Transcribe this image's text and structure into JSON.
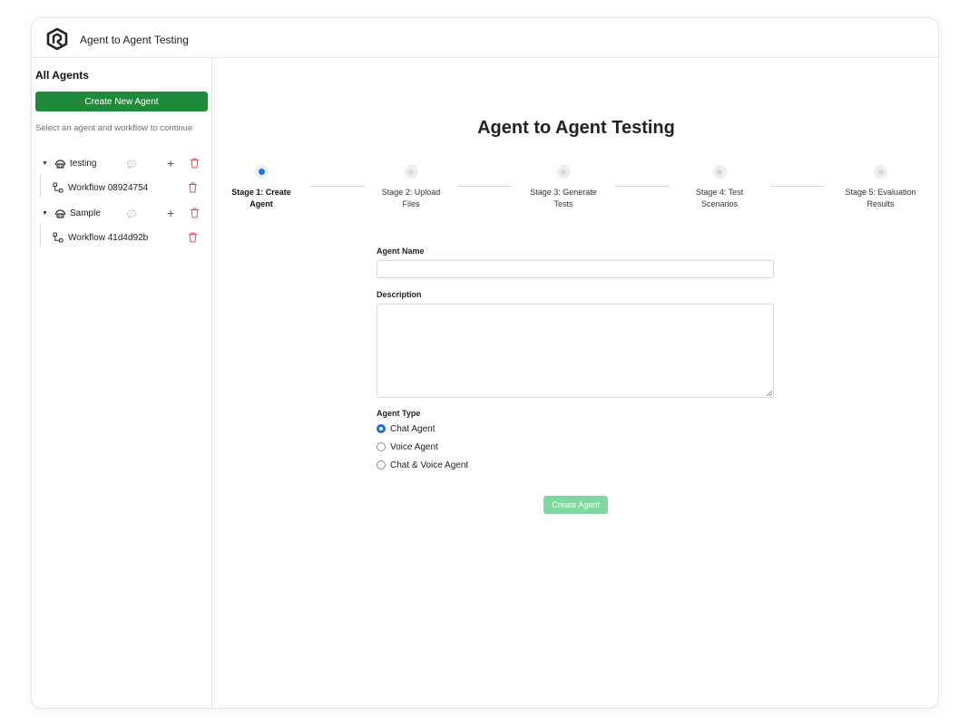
{
  "app": {
    "title": "Agent to Agent Testing",
    "logo_icon": "hexagon-logo-icon"
  },
  "sidebar": {
    "heading": "All Agents",
    "new_agent_label": "Create New Agent",
    "hint": "Select an agent and workflow to continue",
    "agents": [
      {
        "name": "testing",
        "workflows": [
          "Workflow 08924754"
        ]
      },
      {
        "name": "Sample",
        "workflows": [
          "Workflow 41d4d92b"
        ]
      }
    ]
  },
  "main": {
    "title": "Agent to Agent Testing",
    "stages": [
      {
        "line1": "Stage 1: Create",
        "line2": "Agent",
        "active": true
      },
      {
        "line1": "Stage 2: Upload",
        "line2": "Files",
        "active": false
      },
      {
        "line1": "Stage 3: Generate",
        "line2": "Tests",
        "active": false
      },
      {
        "line1": "Stage 4: Test",
        "line2": "Scenarios",
        "active": false
      },
      {
        "line1": "Stage 5: Evaluation",
        "line2": "Results",
        "active": false
      }
    ],
    "form": {
      "agent_name_label": "Agent Name",
      "agent_name_value": "",
      "description_label": "Description",
      "description_value": "",
      "agent_type_label": "Agent Type",
      "agent_types": [
        "Chat Agent",
        "Voice Agent",
        "Chat & Voice Agent"
      ],
      "selected_agent_type": "Chat Agent",
      "submit_label": "Create Agent"
    }
  },
  "colors": {
    "primary_green": "#1f8a3a",
    "disabled_green": "#7fd8a0",
    "active_blue": "#1a73e8",
    "delete_red": "#e0505a"
  }
}
